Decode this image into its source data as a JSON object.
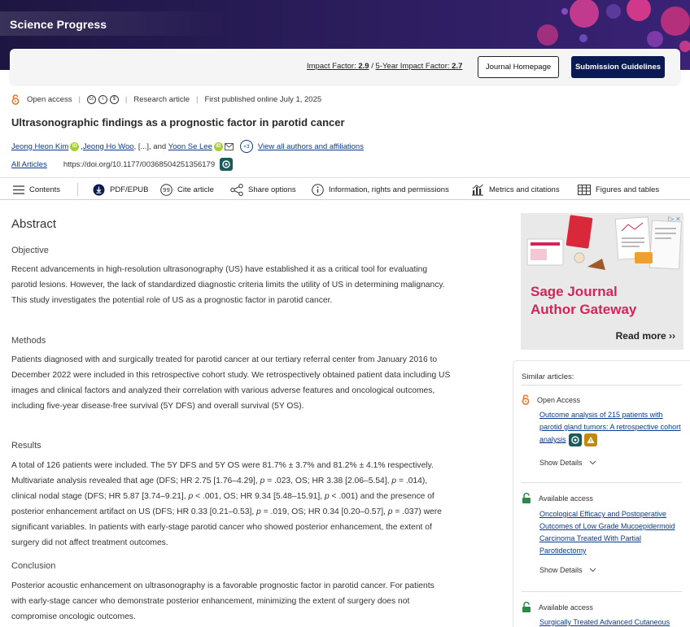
{
  "banner": {
    "journal_name": "Science Progress"
  },
  "header": {
    "impact_label": "Impact Factor: ",
    "impact_value": "2.9",
    "impact_sep": " / ",
    "five_year_label": "5-Year Impact Factor: ",
    "five_year_value": "2.7",
    "journal_homepage": "Journal Homepage",
    "submission_guidelines": "Submission Guidelines"
  },
  "meta": {
    "open_access": "Open access",
    "article_type": "Research article",
    "published": "First published online July 1, 2025"
  },
  "article": {
    "title": "Ultrasonographic findings as a prognostic factor in parotid cancer",
    "authors": {
      "a1": "Jeong Heon Kim",
      "sep1": ", ",
      "a2": "Jeong Ho Woo",
      "ellipsis": ", [...], and ",
      "a3": "Yoon Se Lee",
      "plus": "+3",
      "view_all": "View all authors and affiliations"
    },
    "all_articles": "All Articles",
    "doi": "https://doi.org/10.1177/00368504251356179"
  },
  "toolbar": {
    "contents": "Contents",
    "pdf": "PDF/EPUB",
    "cite": "Cite article",
    "share": "Share options",
    "info": "Information, rights and permissions",
    "metrics": "Metrics and citations",
    "figures": "Figures and tables"
  },
  "abstract": {
    "heading": "Abstract",
    "objective_h": "Objective",
    "objective": "Recent advancements in high-resolution ultrasonography (US) have established it as a critical tool for evaluating parotid lesions. However, the lack of standardized diagnostic criteria limits the utility of US in determining malignancy. This study investigates the potential role of US as a prognostic factor in parotid cancer.",
    "methods_h": "Methods",
    "methods": "Patients diagnosed with and surgically treated for parotid cancer at our tertiary referral center from January 2016 to December 2022 were included in this retrospective cohort study. We retrospectively obtained patient data including US images and clinical factors and analyzed their correlation with various adverse features and oncological outcomes, including five-year disease-free survival (5Y DFS) and overall survival (5Y OS).",
    "results_h": "Results",
    "results_html": "A total of 126 patients were included. The 5Y DFS and 5Y OS were 81.7% ± 3.7% and 81.2% ± 4.1% respectively. Multivariate analysis revealed that age (DFS; HR 2.75 [1.76–4.29], <i>p</i> = .023, OS; HR 3.38 [2.06–5.54], <i>p</i> = .014), clinical nodal stage (DFS; HR 5.87 [3.74–9.21], <i>p</i> &lt; .001, OS; HR 9.34 [5.48–15.91], <i>p</i> &lt; .001) and the presence of posterior enhancement artifact on US (DFS; HR 0.33 [0.21–0.53], <i>p</i> = .019, OS; HR 0.34 [0.20–0.57], <i>p</i> = .037) were significant variables. In patients with early-stage parotid cancer who showed posterior enhancement, the extent of surgery did not affect treatment outcomes.",
    "conclusion_h": "Conclusion",
    "conclusion": "Posterior acoustic enhancement on ultrasonography is a favorable prognostic factor in parotid cancer. For patients with early-stage cancer who demonstrate posterior enhancement, minimizing the extent of surgery does not compromise oncologic outcomes."
  },
  "ad": {
    "title_line1": "Sage Journal",
    "title_line2": "Author Gateway",
    "read_more": "Read more ››",
    "choice": "▷ ×"
  },
  "similar": {
    "heading": "Similar articles:",
    "items": [
      {
        "access": "Open Access",
        "title": "Outcome analysis of 215 patients with parotid gland tumors: A retrospective cohort analysis",
        "details": "Show Details"
      },
      {
        "access": "Available access",
        "title": "Oncological Efficacy and Postoperative Outcomes of Low Grade Mucoepidermoid Carcinoma Treated With Partial Parotidectomy",
        "details": "Show Details"
      },
      {
        "access": "Available access",
        "title": "Surgically Treated Advanced Cutaneous",
        "details": ""
      }
    ]
  },
  "colors": {
    "brand_navy": "#0b1b52",
    "link": "#0a3a8c",
    "ad_pink": "#d6245a",
    "open_access_orange": "#e8762d",
    "lock_green": "#2a8a4a"
  }
}
